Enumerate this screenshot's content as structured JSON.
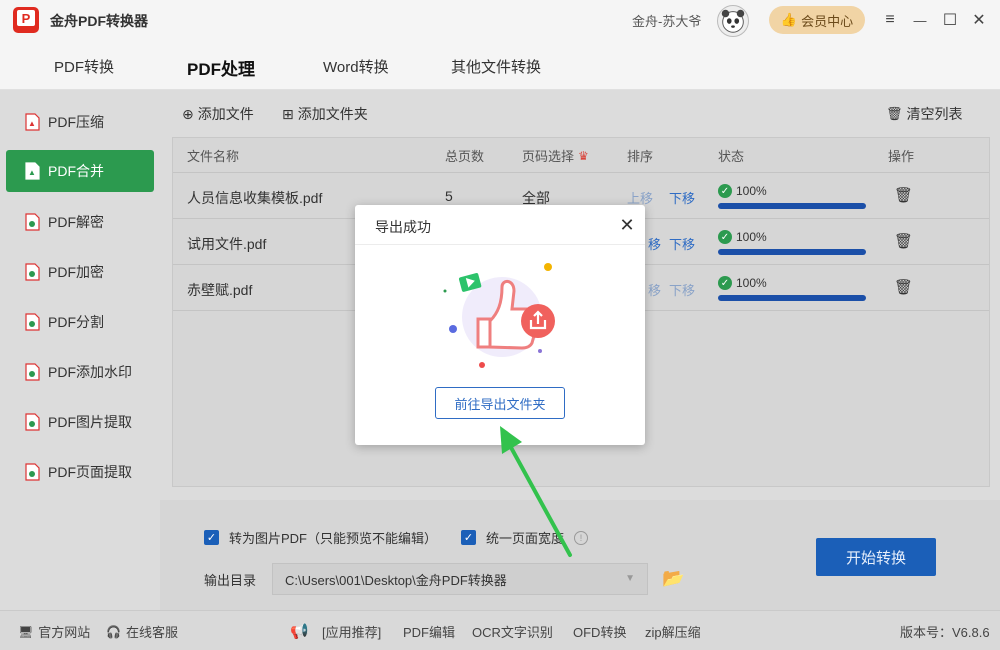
{
  "app": {
    "title": "金舟PDF转换器",
    "logo_text": "P"
  },
  "user": {
    "name": "金舟-苏大爷",
    "vip_label": "会员中心"
  },
  "window": {
    "menu_icon": "≡",
    "minimize_icon": "—",
    "maximize_icon": "☐",
    "close_icon": "✕"
  },
  "main_tabs": [
    {
      "label": "PDF转换"
    },
    {
      "label": "PDF处理"
    },
    {
      "label": "Word转换"
    },
    {
      "label": "其他文件转换"
    }
  ],
  "sidebar": {
    "items": [
      {
        "label": "PDF压缩"
      },
      {
        "label": "PDF合并"
      },
      {
        "label": "PDF解密"
      },
      {
        "label": "PDF加密"
      },
      {
        "label": "PDF分割"
      },
      {
        "label": "PDF添加水印"
      },
      {
        "label": "PDF图片提取"
      },
      {
        "label": "PDF页面提取"
      }
    ]
  },
  "toolbar": {
    "add_file": "添加文件",
    "add_folder": "添加文件夹",
    "clear_list": "清空列表"
  },
  "table": {
    "headers": {
      "name": "文件名称",
      "pages": "总页数",
      "range": "页码选择",
      "order": "排序",
      "status": "状态",
      "action": "操作"
    },
    "rows": [
      {
        "name": "人员信息收集模板.pdf",
        "pages": "5",
        "range": "全部",
        "up": "上移",
        "down": "下移",
        "progress_label": "100%",
        "progress": 1.0
      },
      {
        "name": "试用文件.pdf",
        "pages": "",
        "range": "",
        "up": "移",
        "down": "下移",
        "progress_label": "100%",
        "progress": 1.0
      },
      {
        "name": "赤壁赋.pdf",
        "pages": "",
        "range": "",
        "up": "移",
        "down": "下移",
        "progress_label": "100%",
        "progress": 1.0
      }
    ]
  },
  "options": {
    "to_image_pdf": "转为图片PDF（只能预览不能编辑）",
    "unify_width": "统一页面宽度",
    "output_label": "输出目录",
    "output_path": "C:\\Users\\001\\Desktop\\金舟PDF转换器",
    "start_button": "开始转换"
  },
  "statusbar": {
    "website": "官方网站",
    "service": "在线客服",
    "links": [
      "[应用推荐]",
      "PDF编辑",
      "OCR文字识别",
      "OFD转换",
      "zip解压缩"
    ],
    "version": "版本号：V6.8.6"
  },
  "modal": {
    "title": "导出成功",
    "button": "前往导出文件夹"
  },
  "colors": {
    "accent_green": "#2c9a4f",
    "accent_blue": "#1b5fb8",
    "vip_gold": "#f1d4a5"
  }
}
